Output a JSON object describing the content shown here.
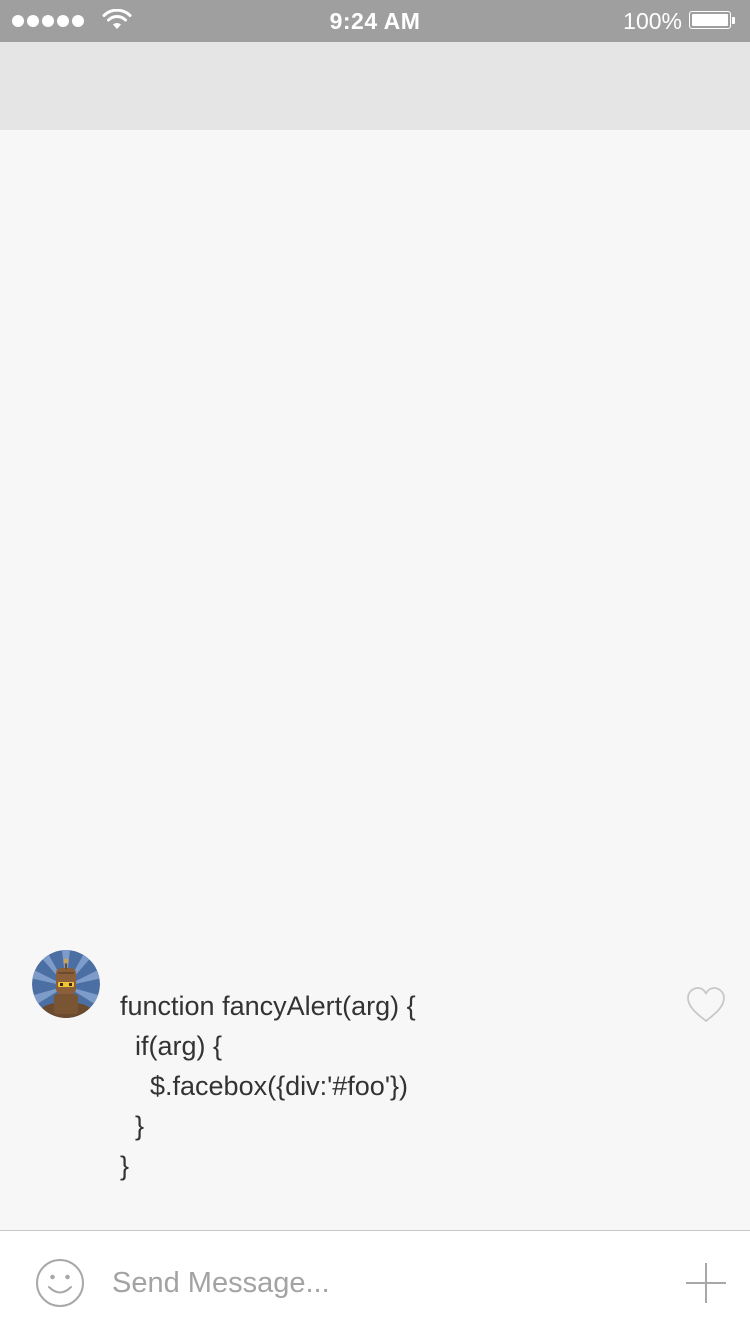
{
  "status_bar": {
    "time": "9:24 AM",
    "battery_percent": "100%",
    "battery_level": 1.0,
    "signal_bars": 5,
    "icons": [
      "signal-dots-icon",
      "wifi-icon",
      "battery-icon"
    ]
  },
  "nav_bar": {
    "title": ""
  },
  "messages": [
    {
      "avatar_icon": "robot-avatar-icon",
      "text": "function fancyAlert(arg) {\n  if(arg) {\n    $.facebox({div:'#foo'})\n  }\n}",
      "like_icon": "heart-outline-icon",
      "liked": false
    }
  ],
  "input_bar": {
    "emoji_icon": "smiley-icon",
    "placeholder": "Send Message...",
    "value": "",
    "add_icon": "plus-icon"
  },
  "colors": {
    "status_bar_bg": "#9f9f9f",
    "nav_bar_bg": "#e5e5e5",
    "content_bg": "#f7f7f7",
    "text": "#333333",
    "placeholder": "#a3a3a3",
    "icon_gray": "#a8a8a8"
  }
}
